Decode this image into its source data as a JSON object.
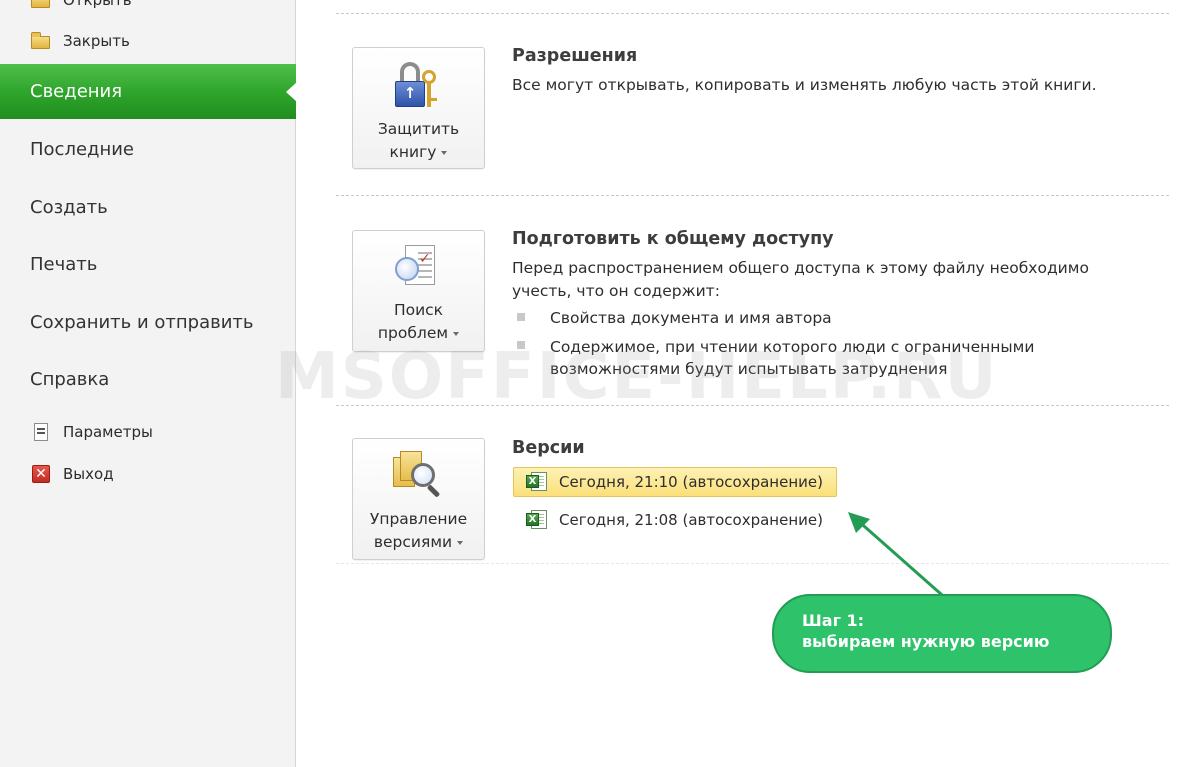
{
  "sidebar": {
    "open_label": "Открыть",
    "close_label": "Закрыть",
    "active_label": "Сведения",
    "recent_label": "Последние",
    "new_label": "Создать",
    "print_label": "Печать",
    "save_send_label": "Сохранить и отправить",
    "help_label": "Справка",
    "options_label": "Параметры",
    "exit_label": "Выход"
  },
  "permissions": {
    "button_line1": "Защитить",
    "button_line2": "книгу",
    "title": "Разрешения",
    "text": "Все могут открывать, копировать и изменять любую часть этой книги."
  },
  "prepare": {
    "button_line1": "Поиск",
    "button_line2": "проблем",
    "title": "Подготовить к общему доступу",
    "text_line1": "Перед распространением общего доступа к этому файлу необходимо",
    "text_line2": "учесть, что он содержит:",
    "bullets": [
      "Свойства документа и имя автора",
      "Содержимое, при чтении которого люди с ограниченными"
    ],
    "bullet2_line2": "возможностями будут испытывать затруднения"
  },
  "versions": {
    "button_line1": "Управление",
    "button_line2": "версиями",
    "title": "Версии",
    "items": [
      "Сегодня, 21:10 (автосохранение)",
      "Сегодня, 21:08 (автосохранение)"
    ]
  },
  "watermark": "MSOFFICE-HELP.RU",
  "callout": {
    "line1": "Шаг 1:",
    "line2": "выбираем нужную версию",
    "color": "#2ec26b"
  },
  "colors": {
    "active_sidebar": "#2da32a",
    "highlight": "#fbe07a"
  }
}
